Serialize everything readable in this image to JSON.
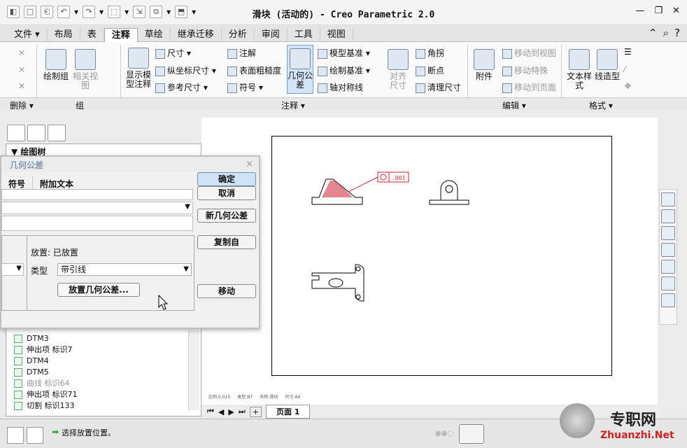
{
  "window": {
    "title": "滑块 (活动的) - Creo Parametric 2.0",
    "min": "—",
    "restore": "❐",
    "close": "✕"
  },
  "qat": [
    "◧",
    "□",
    "⎗",
    "↶",
    "▾",
    "↷",
    "▾",
    "⬚",
    "▾",
    "⇲",
    "⧉",
    "▾",
    "⬒",
    "▾"
  ],
  "tabs": [
    {
      "label": "文件 ▾"
    },
    {
      "label": "布局"
    },
    {
      "label": "表"
    },
    {
      "label": "注释"
    },
    {
      "label": "草绘"
    },
    {
      "label": "继承迁移"
    },
    {
      "label": "分析"
    },
    {
      "label": "审阅"
    },
    {
      "label": "工具"
    },
    {
      "label": "视图"
    }
  ],
  "ribbon": {
    "draw_component": "绘制组",
    "related_view": "相关视图",
    "show_model_annot": "显示模型注释",
    "dimension": "尺寸",
    "ordinate_dim": "纵坐标尺寸",
    "reference_dim": "参考尺寸",
    "note": "注解",
    "surface_finish": "表面粗糙度",
    "symbol": "符号",
    "gtol": "几何公差",
    "model_datum": "模型基准",
    "draw_datum": "绘制基准",
    "axis_symmetry": "轴对称线",
    "align_dim": "对齐尺寸",
    "jog": "角拐",
    "breakpoint": "断点",
    "cleanup_dim": "清理尺寸",
    "attachment": "附件",
    "move_to_view": "移动到视图",
    "move_special": "移动特殊",
    "move_to_page": "移动到页面",
    "text_style": "文本样式",
    "line_style": "线造型"
  },
  "groups": {
    "delete": "删除 ▾",
    "group": "组",
    "annotation": "注释 ▾",
    "edit": "编辑 ▾",
    "format": "格式 ▾"
  },
  "tree": {
    "header": "绘图树",
    "items": [
      {
        "label": "DTM3"
      },
      {
        "label": "伸出项 标识7"
      },
      {
        "label": "DTM4"
      },
      {
        "label": "DTM5"
      },
      {
        "label": "曲线 标识64"
      },
      {
        "label": "伸出项 标识71"
      },
      {
        "label": "切割 标识133"
      }
    ]
  },
  "dialog": {
    "title": "几何公差",
    "close": "×",
    "tab_symbol": "符号",
    "tab_text": "附加文本",
    "placement_label": "放置:",
    "placement_value": "已放置",
    "type_label": "类型",
    "type_value": "带引线",
    "place_button": "放置几何公差...",
    "ok": "确定",
    "cancel": "取消",
    "new": "新几何公差",
    "copy_from": "复制自",
    "move": "移动"
  },
  "drawing": {
    "gtol_value": ".001"
  },
  "sheet_info": {
    "scale": "比例:0.015",
    "type": "类型:NT",
    "name": "名称:滑块",
    "size": "尺寸:A4",
    "page": "页面 1"
  },
  "status": {
    "message": "选择放置位置。"
  },
  "watermark": {
    "cn": "专职网",
    "url": "Zhuanzhi.Net"
  }
}
